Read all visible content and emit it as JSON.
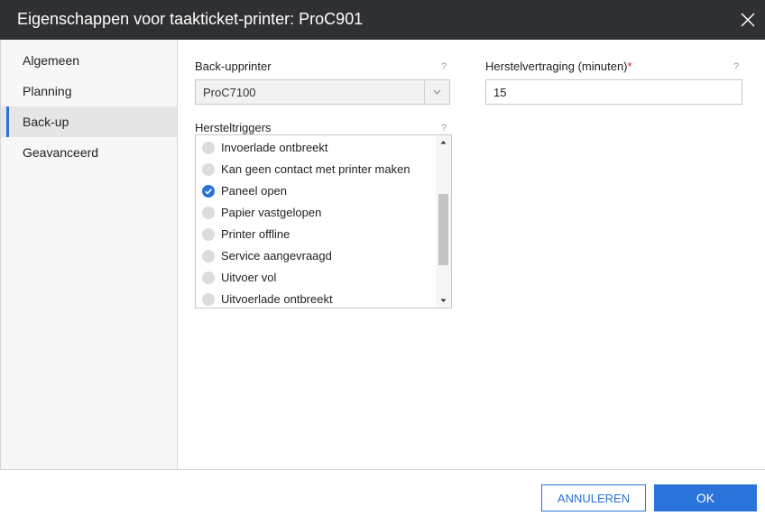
{
  "dialog": {
    "title": "Eigenschappen voor taakticket-printer: ProC901"
  },
  "sidebar": {
    "items": [
      {
        "label": "Algemeen"
      },
      {
        "label": "Planning"
      },
      {
        "label": "Back-up",
        "active": true
      },
      {
        "label": "Geavanceerd"
      }
    ]
  },
  "backup_printer": {
    "label": "Back-upprinter",
    "help": "?",
    "value": "ProC7100"
  },
  "recovery_delay": {
    "label": "Herstelvertraging (minuten)",
    "required_mark": "*",
    "help": "?",
    "value": "15"
  },
  "recovery_triggers": {
    "label": "Hersteltriggers",
    "help": "?",
    "items": [
      {
        "label": "Invoerlade ontbreekt",
        "checked": false
      },
      {
        "label": "Kan geen contact met printer maken",
        "checked": false
      },
      {
        "label": "Paneel open",
        "checked": true
      },
      {
        "label": "Papier vastgelopen",
        "checked": false
      },
      {
        "label": "Printer offline",
        "checked": false
      },
      {
        "label": "Service aangevraagd",
        "checked": false
      },
      {
        "label": "Uitvoer vol",
        "checked": false
      },
      {
        "label": "Uitvoerlade ontbreekt",
        "checked": false
      }
    ]
  },
  "footer": {
    "cancel_label": "ANNULEREN",
    "ok_label": "OK"
  },
  "colors": {
    "accent": "#2a73d8",
    "titlebar": "#2e3033",
    "required": "#d42020"
  },
  "icons": {
    "close": "close-icon",
    "dropdown": "chevron-down-icon",
    "checked": "checkmark-icon"
  }
}
